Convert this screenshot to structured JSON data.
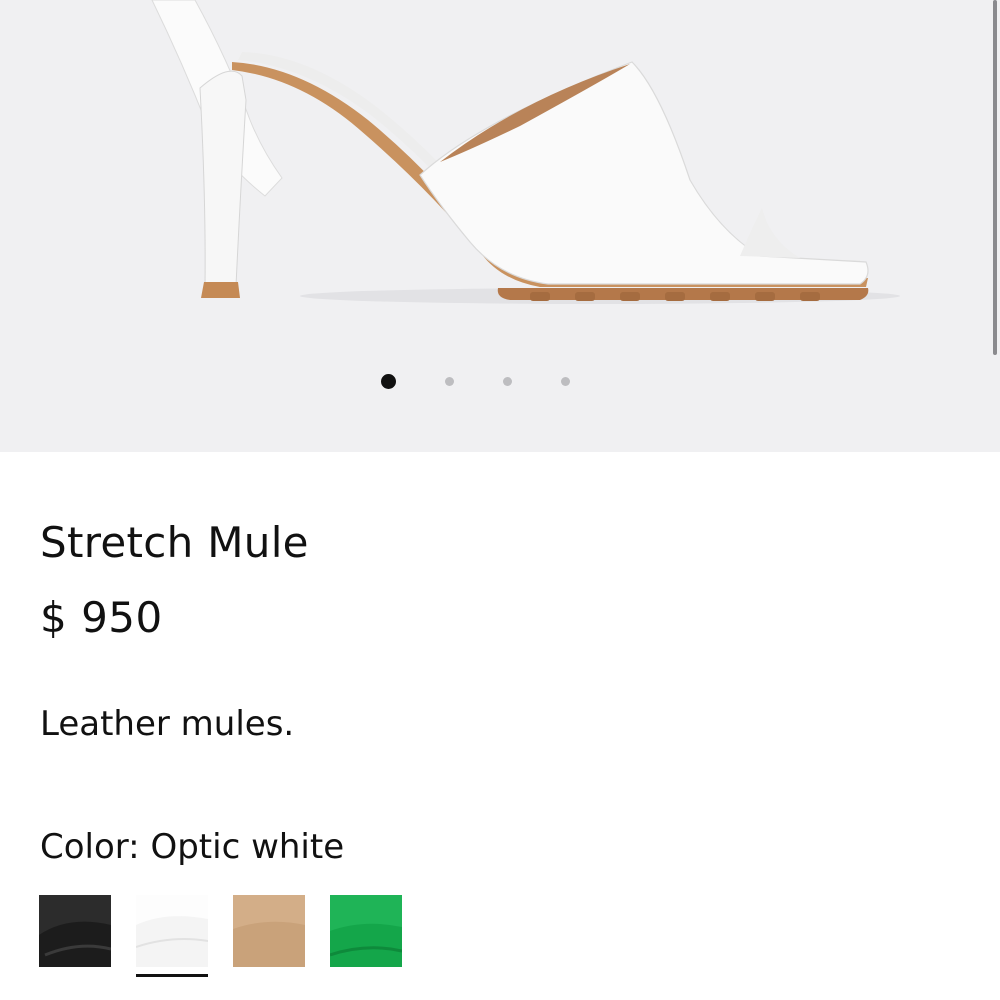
{
  "gallery": {
    "image_alt": "white leather square-toe heeled mule",
    "image_count": 4,
    "active_index": 0
  },
  "product": {
    "title": "Stretch Mule",
    "price": "$ 950",
    "description": "Leather mules."
  },
  "color": {
    "label": "Color:",
    "selected": "Optic white",
    "swatches": [
      {
        "name": "Black",
        "hex": "#1c1c1c"
      },
      {
        "name": "Optic white",
        "hex": "#f4f4f4"
      },
      {
        "name": "Tan",
        "hex": "#c9a27a"
      },
      {
        "name": "Green",
        "hex": "#14a64a"
      }
    ]
  }
}
